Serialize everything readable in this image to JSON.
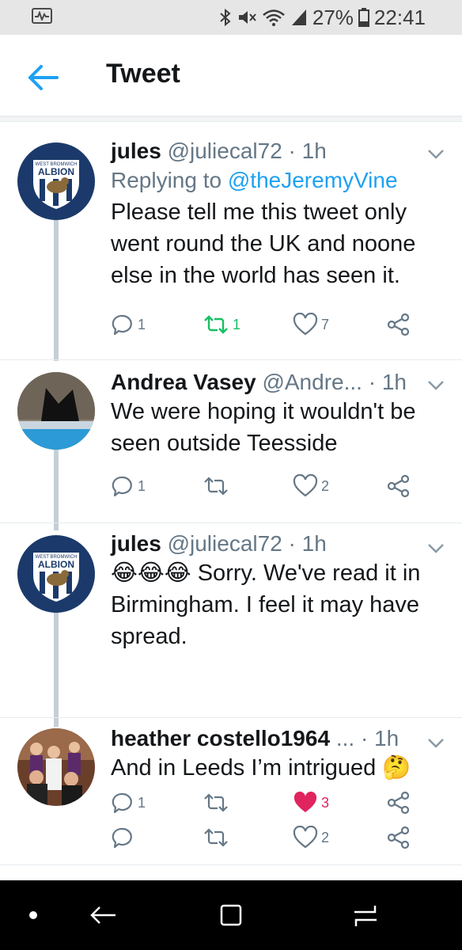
{
  "status_bar": {
    "battery_percent": "27%",
    "time": "22:41",
    "icons": [
      "app-activity-icon",
      "bluetooth-icon",
      "mute-icon",
      "wifi-icon",
      "signal-icon",
      "battery-icon"
    ]
  },
  "header": {
    "title": "Tweet",
    "back_icon": "arrow-left-icon"
  },
  "tweets": [
    {
      "name": "jules",
      "handle": "@juliecal72",
      "time": "1h",
      "replying_label": "Replying to",
      "replying_to": "@theJeremyVine",
      "text": "Please tell me this tweet only went round the UK and noone else in the world has seen it.",
      "avatar_text_top": "WEST BROMWICH",
      "avatar_text_main": "ALBION",
      "replies": "1",
      "retweets": "1",
      "likes": "7"
    },
    {
      "name": "Andrea Vasey",
      "handle": "@Andre...",
      "time": "1h",
      "text": "We were hoping it wouldn't be seen outside Teesside",
      "replies": "1",
      "retweets": "",
      "likes": "2"
    },
    {
      "name": "jules",
      "handle": "@juliecal72",
      "time": "1h",
      "emoji": "😂😂😂",
      "text": "Sorry. We've read it in Birmingham. I feel it may have spread.",
      "avatar_text_top": "WEST BROMWICH",
      "avatar_text_main": "ALBION",
      "replies": "1",
      "retweets": "",
      "likes": "3"
    },
    {
      "name": "heather costello1964",
      "handle": "...",
      "time": "1h",
      "text": "And in Leeds I’m intrigued",
      "emoji": "🤔",
      "replies": "",
      "retweets": "",
      "likes": "2"
    }
  ],
  "colors": {
    "accent_blue": "#1da1f2",
    "retweet_green": "#17bf63",
    "like_red": "#e0245e",
    "albion_navy": "#1b3a6b"
  }
}
